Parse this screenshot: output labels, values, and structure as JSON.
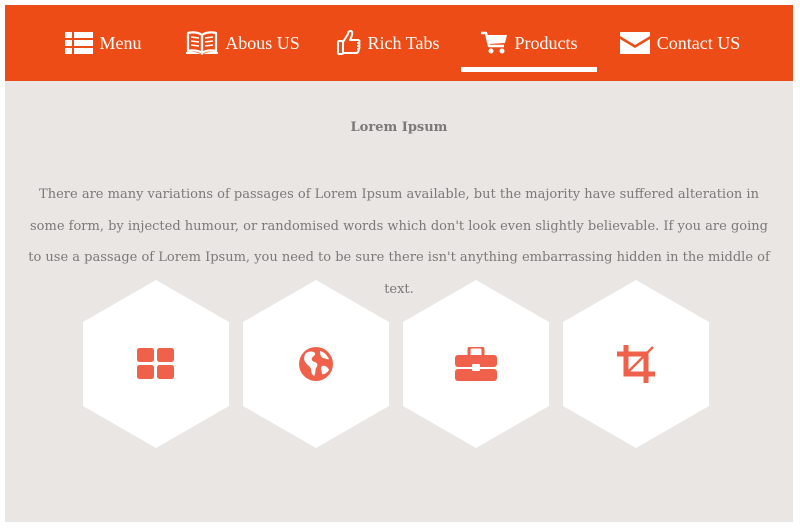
{
  "nav": {
    "items": [
      {
        "label": "Menu",
        "icon": "list-icon"
      },
      {
        "label": "Abous US",
        "icon": "book-icon"
      },
      {
        "label": "Rich Tabs",
        "icon": "thumbs-up-icon"
      },
      {
        "label": "Products",
        "icon": "cart-icon",
        "active": true
      },
      {
        "label": "Contact US",
        "icon": "envelope-icon"
      }
    ]
  },
  "content": {
    "title": "Lorem Ipsum",
    "paragraph": "There are many variations of passages of Lorem Ipsum available, but the majority have suffered alteration in some form, by injected humour, or randomised words which don't look even slightly believable. If you are going to use a passage of Lorem Ipsum, you need to be sure there isn't anything embarrassing hidden in the middle of text."
  },
  "tiles": [
    {
      "icon": "grid-icon"
    },
    {
      "icon": "globe-icon"
    },
    {
      "icon": "briefcase-icon"
    },
    {
      "icon": "crop-icon"
    }
  ],
  "colors": {
    "brand": "#ee4c17",
    "icon": "#f0614b",
    "background": "#e9e6e4",
    "text": "#7d7877",
    "tile": "#ffffff"
  }
}
